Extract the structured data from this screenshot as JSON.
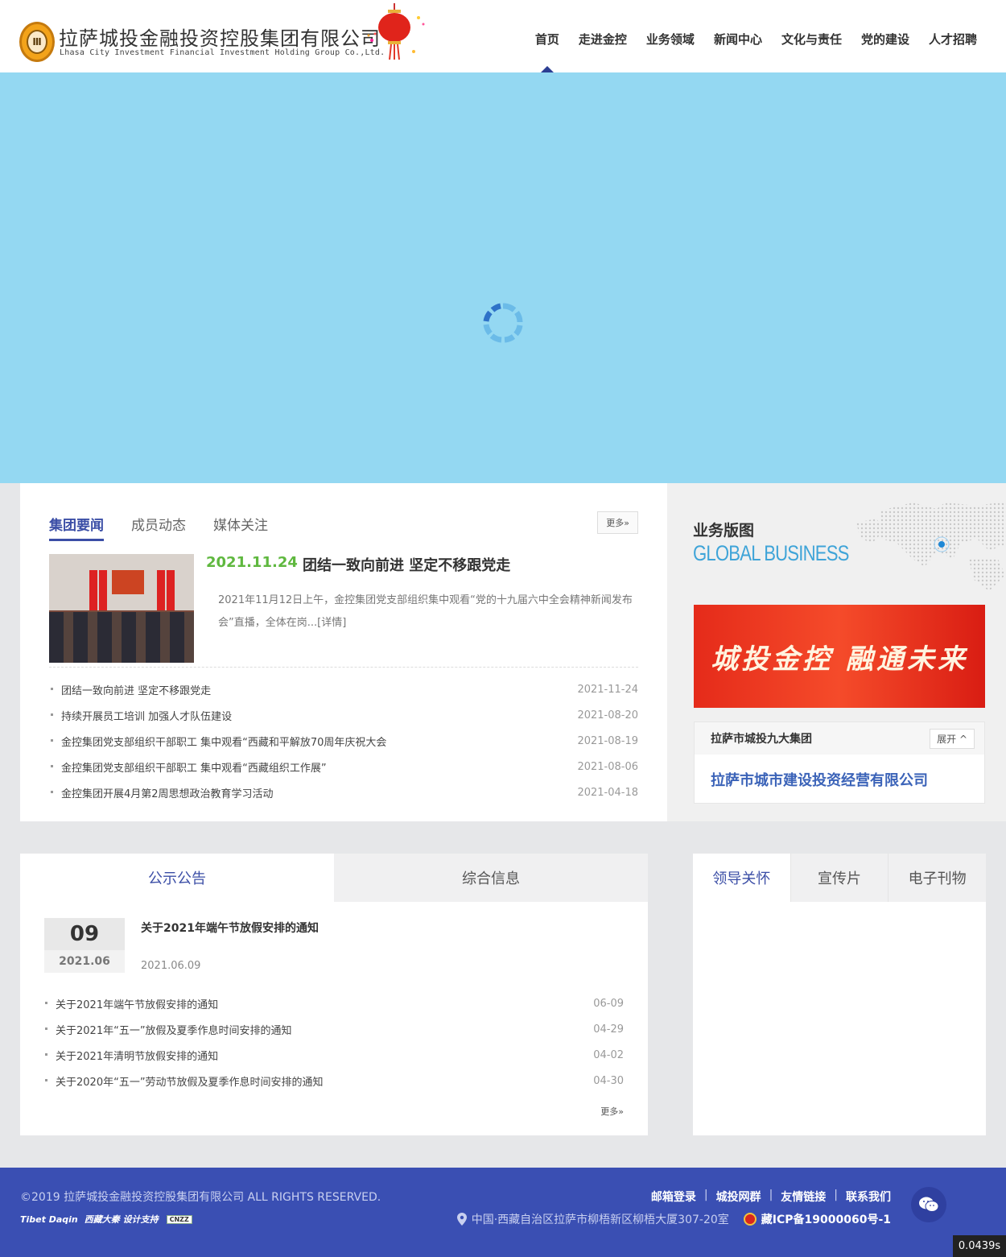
{
  "header": {
    "company_cn": "拉萨城投金融投资控股集团有限公司",
    "company_en": "Lhasa City Investment Financial Investment Holding Group Co.,Ltd.",
    "nav": [
      "首页",
      "走进金控",
      "业务领域",
      "新闻中心",
      "文化与责任",
      "党的建设",
      "人才招聘"
    ],
    "nav_active": "首页"
  },
  "news": {
    "tabs": [
      "集团要闻",
      "成员动态",
      "媒体关注"
    ],
    "active_tab": "集团要闻",
    "more": "更多»",
    "featured": {
      "date": "2021.11.24",
      "title": "团结一致向前进 坚定不移跟党走",
      "summary": "2021年11月12日上午，金控集团党支部组织集中观看“党的十九届六中全会精神新闻发布会”直播，全体在岗...[详情]"
    },
    "items": [
      {
        "title": "团结一致向前进 坚定不移跟党走",
        "date": "2021-11-24"
      },
      {
        "title": "持续开展员工培训 加强人才队伍建设",
        "date": "2021-08-20"
      },
      {
        "title": "金控集团党支部组织干部职工 集中观看“西藏和平解放70周年庆祝大会",
        "date": "2021-08-19"
      },
      {
        "title": "金控集团党支部组织干部职工 集中观看“西藏组织工作展”",
        "date": "2021-08-06"
      },
      {
        "title": "金控集团开展4月第2周思想政治教育学习活动",
        "date": "2021-04-18"
      }
    ]
  },
  "business": {
    "title_cn": "业务版图",
    "title_en": "GLOBAL BUSINESS",
    "banner_text": "城投金控 融通未来",
    "group_title": "拉萨市城投九大集团",
    "expand": "展开",
    "company": "拉萨市城市建设投资经营有限公司"
  },
  "notice": {
    "tabs": [
      "公示公告",
      "综合信息"
    ],
    "active_tab": "公示公告",
    "featured": {
      "day": "09",
      "year_month": "2021.06",
      "title": "关于2021年端午节放假安排的通知",
      "date": "2021.06.09"
    },
    "items": [
      {
        "title": "关于2021年端午节放假安排的通知",
        "date": "06-09"
      },
      {
        "title": "关于2021年“五一”放假及夏季作息时间安排的通知",
        "date": "04-29"
      },
      {
        "title": "关于2021年清明节放假安排的通知",
        "date": "04-02"
      },
      {
        "title": "关于2020年“五一”劳动节放假及夏季作息时间安排的通知",
        "date": "04-30"
      }
    ],
    "more": "更多»"
  },
  "leader": {
    "tabs": [
      "领导关怀",
      "宣传片",
      "电子刊物"
    ],
    "active_tab": "领导关怀"
  },
  "footer": {
    "copyright": "©2019 拉萨城投金融投资控股集团有限公司  ALL RIGHTS RESERVED.",
    "credit_brand": "Tibet Daqin",
    "credit_cn": "西藏大秦 设计支持",
    "cnzz": "CNZZ",
    "links": [
      "邮箱登录",
      "城投网群",
      "友情链接",
      "联系我们"
    ],
    "address": "中国·西藏自治区拉萨市柳梧新区柳梧大厦307-20室",
    "icp": "藏ICP备19000060号-1"
  },
  "timer": "0.0439s",
  "colors": {
    "primary": "#3b4ea6",
    "banner_bg": "#94d8f2",
    "footer_bg": "#3a4fb3",
    "date_green": "#5fb83f",
    "global_blue": "#3fa4d8",
    "red_banner": "#e52b1a"
  }
}
